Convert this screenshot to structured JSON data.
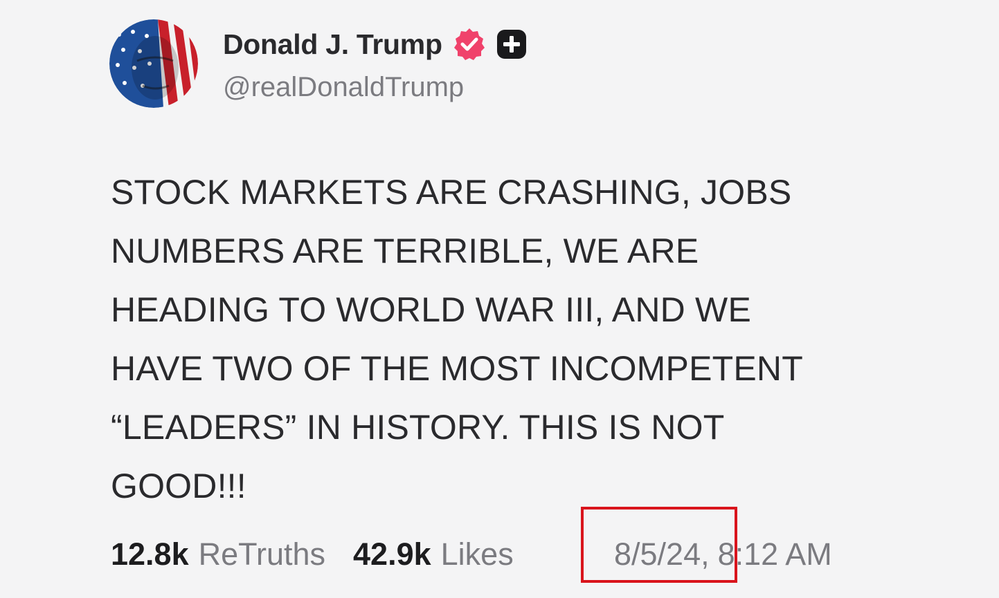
{
  "author": {
    "display_name": "Donald J. Trump",
    "handle": "@realDonaldTrump",
    "verified_color": "#f0426b",
    "avatar_icon": "flag-portrait-avatar",
    "badge_icons": [
      "verified-badge-icon",
      "plus-badge-icon"
    ]
  },
  "post": {
    "text": "STOCK MARKETS ARE CRASHING, JOBS\nNUMBERS ARE TERRIBLE, WE ARE\nHEADING TO WORLD WAR III, AND WE\nHAVE TWO OF THE MOST INCOMPETENT\n“LEADERS” IN HISTORY. THIS IS NOT\nGOOD!!!"
  },
  "stats": {
    "retruths_count": "12.8k",
    "retruths_label": "ReTruths",
    "likes_count": "42.9k",
    "likes_label": "Likes"
  },
  "timestamp": {
    "date": "8/5/24,",
    "time": "8:12 AM"
  },
  "annotation": {
    "highlight_color": "#d9141c"
  }
}
